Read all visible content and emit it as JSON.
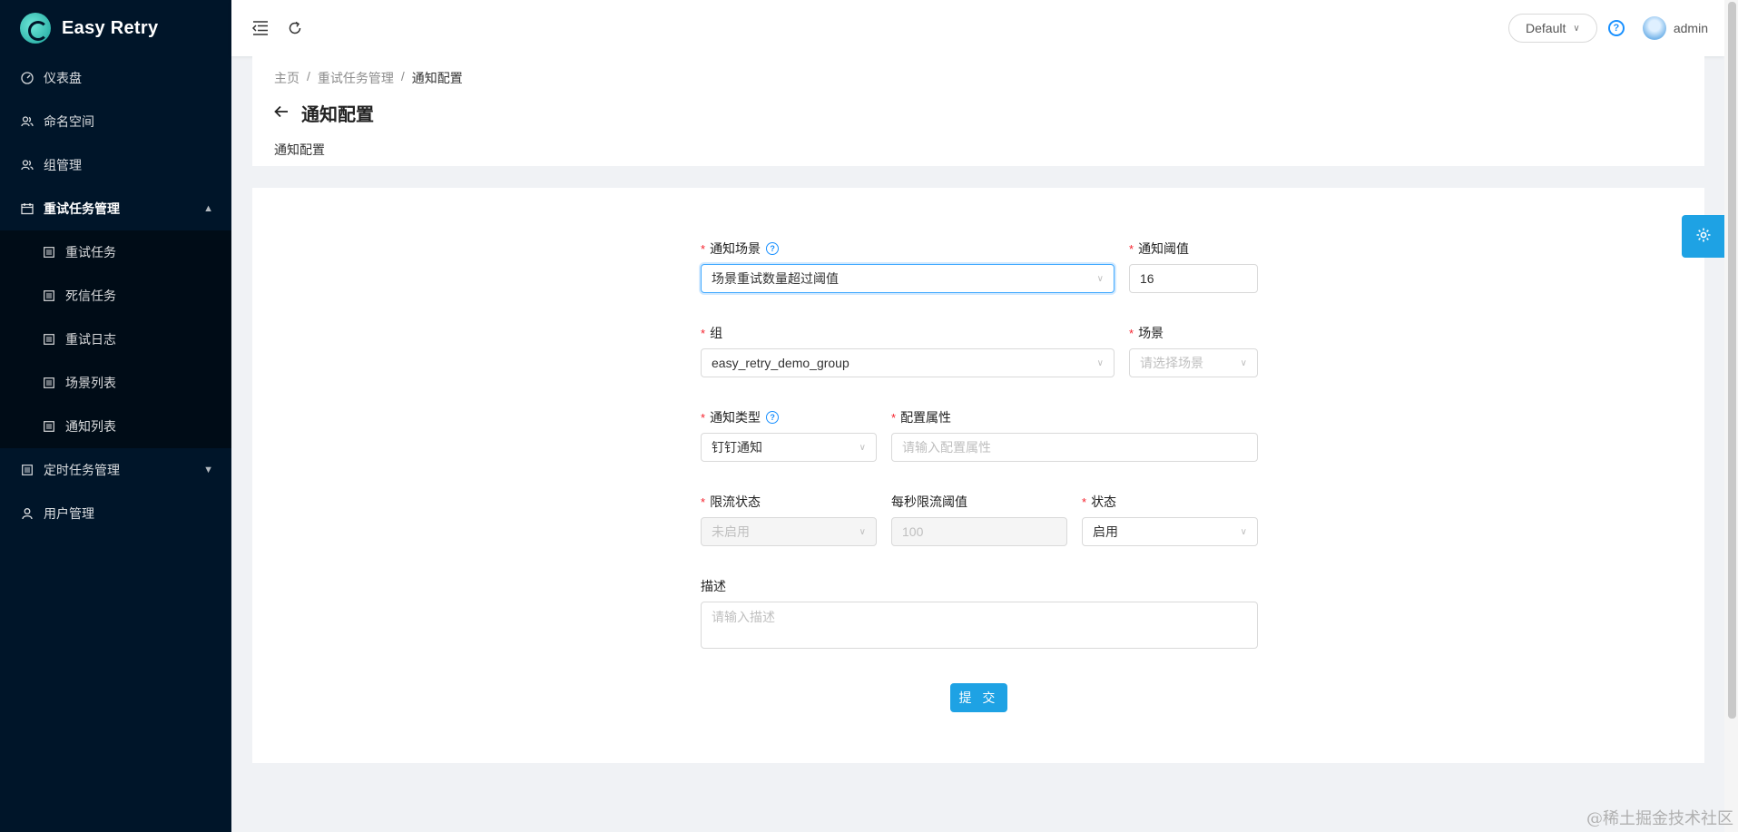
{
  "app": {
    "name": "Easy Retry"
  },
  "sidebar": {
    "items": [
      {
        "label": "仪表盘",
        "icon": "dashboard-icon"
      },
      {
        "label": "命名空间",
        "icon": "users-icon"
      },
      {
        "label": "组管理",
        "icon": "users-icon"
      },
      {
        "label": "重试任务管理",
        "icon": "calendar-icon",
        "expanded": true,
        "children": [
          {
            "label": "重试任务",
            "icon": "file-icon"
          },
          {
            "label": "死信任务",
            "icon": "file-icon"
          },
          {
            "label": "重试日志",
            "icon": "file-icon"
          },
          {
            "label": "场景列表",
            "icon": "file-icon"
          },
          {
            "label": "通知列表",
            "icon": "file-icon"
          }
        ]
      },
      {
        "label": "定时任务管理",
        "icon": "file-icon"
      },
      {
        "label": "用户管理",
        "icon": "user-icon"
      }
    ]
  },
  "header": {
    "namespace": "Default",
    "user": "admin"
  },
  "breadcrumb": [
    "主页",
    "重试任务管理",
    "通知配置"
  ],
  "page": {
    "title": "通知配置",
    "description": "通知配置"
  },
  "form": {
    "notify_scene": {
      "label": "通知场景",
      "value": "场景重试数量超过阈值"
    },
    "notify_threshold": {
      "label": "通知阈值",
      "value": "16"
    },
    "group": {
      "label": "组",
      "value": "easy_retry_demo_group"
    },
    "scene": {
      "label": "场景",
      "placeholder": "请选择场景"
    },
    "notify_type": {
      "label": "通知类型",
      "value": "钉钉通知"
    },
    "config_attr": {
      "label": "配置属性",
      "placeholder": "请输入配置属性"
    },
    "rate_limit_status": {
      "label": "限流状态",
      "value": "未启用"
    },
    "rate_limit_per_sec": {
      "label": "每秒限流阈值",
      "value": "100"
    },
    "status": {
      "label": "状态",
      "value": "启用"
    },
    "description": {
      "label": "描述",
      "placeholder": "请输入描述"
    },
    "submit_label": "提 交"
  },
  "watermark": "@稀土掘金技术社区",
  "colors": {
    "sidebar_bg": "#001529",
    "submenu_bg": "#000c17",
    "primary": "#1ea2e4",
    "required": "#f5222d"
  }
}
